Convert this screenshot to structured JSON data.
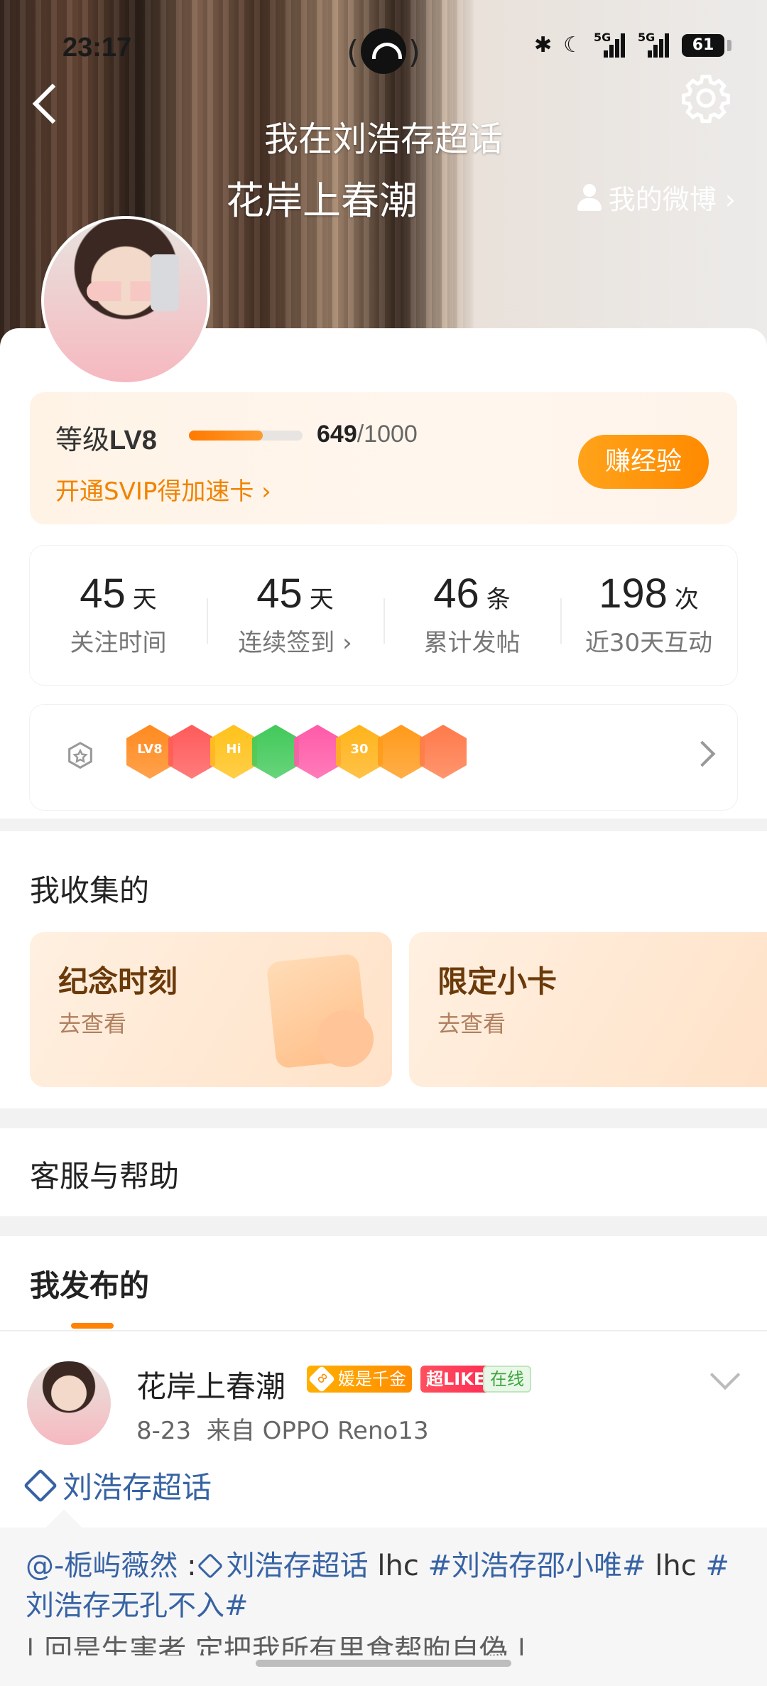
{
  "status_bar": {
    "time": "23:17",
    "signal1": "5G",
    "signal2": "5G",
    "battery": "61"
  },
  "nav": {
    "title": "我在刘浩存超话"
  },
  "profile": {
    "name": "花岸上春潮",
    "my_weibo": "我的微博 ›"
  },
  "level": {
    "label_prefix": "等级",
    "level": "LV8",
    "progress_current": "649",
    "progress_total": "/1000",
    "progress_fraction": 0.649,
    "svip_text": "开通SVIP得加速卡 ›",
    "earn_button": "赚经验"
  },
  "stats": [
    {
      "num": "45",
      "unit": "天",
      "label": "关注时间"
    },
    {
      "num": "45",
      "unit": "天",
      "label": "连续签到 ›"
    },
    {
      "num": "46",
      "unit": "条",
      "label": "累计发帖"
    },
    {
      "num": "198",
      "unit": "次",
      "label": "近30天互动"
    }
  ],
  "badges": [
    {
      "text": "LV8",
      "color": "#ff8a1f"
    },
    {
      "text": "",
      "color": "#ff5a5a"
    },
    {
      "text": "Hi",
      "color": "#ffc21a"
    },
    {
      "text": "",
      "color": "#42c95a"
    },
    {
      "text": "",
      "color": "#ff5aa8"
    },
    {
      "text": "30",
      "color": "#ffb31a"
    },
    {
      "text": "",
      "color": "#ff9a1a"
    },
    {
      "text": "",
      "color": "#ff7a4a"
    }
  ],
  "collection": {
    "title": "我收集的",
    "tiles": [
      {
        "title": "纪念时刻",
        "action": "去查看"
      },
      {
        "title": "限定小卡",
        "action": "去查看"
      }
    ]
  },
  "help": {
    "title": "客服与帮助"
  },
  "posts": {
    "tab": "我发布的",
    "item": {
      "name": "花岸上春潮",
      "fan_badge": "媛是千金",
      "like_badge": "超LIKE",
      "online_badge": "在线",
      "date": "8-23",
      "from_label": "来自",
      "device": "OPPO Reno13",
      "topic": "刘浩存超话",
      "repost_user": "@-栀屿薇然",
      "repost_sep": " :",
      "repost_topic": "刘浩存超话",
      "repost_rest1": " lhc ",
      "repost_tag1": "#刘浩存邵小唯#",
      "repost_rest2": " lhc ",
      "repost_tag2": "#刘浩存无孔不入#",
      "repost_cut": "| 回是生害者 定把我所有里食帮昫自偽 |"
    }
  },
  "colors": {
    "accent": "#ff8200",
    "link": "#3763a4"
  }
}
